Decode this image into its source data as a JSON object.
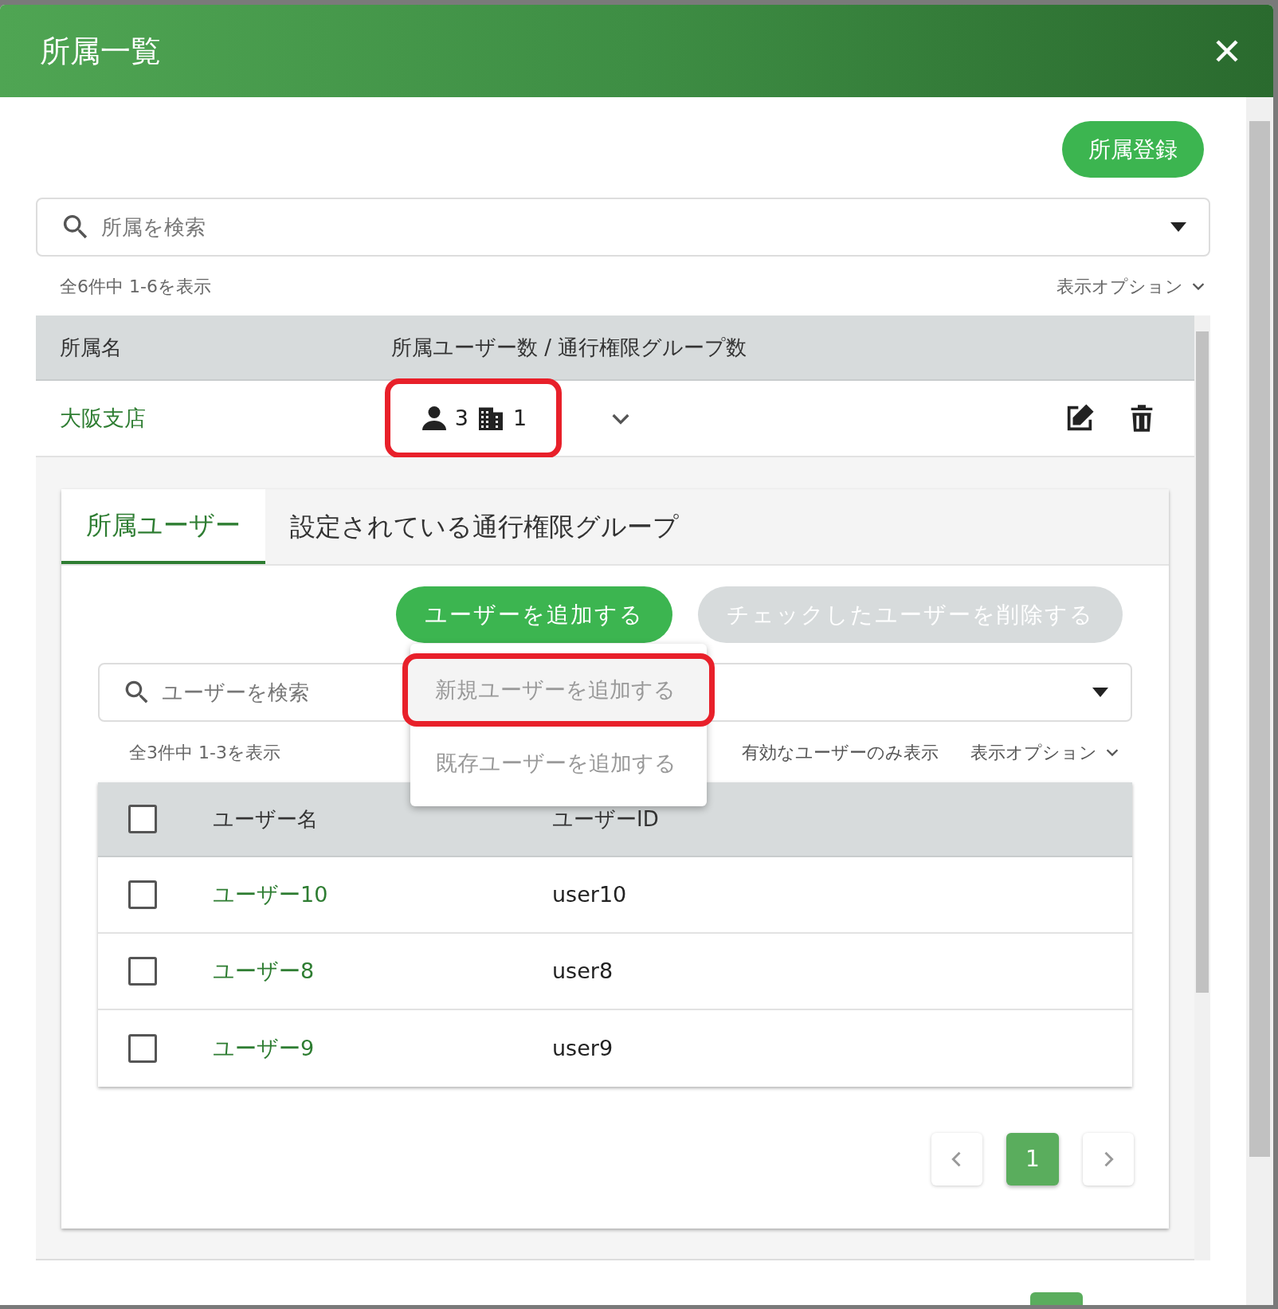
{
  "dialog": {
    "title": "所属一覧"
  },
  "register_button": "所属登録",
  "search": {
    "placeholder": "所属を検索"
  },
  "summary": "全6件中 1-6を表示",
  "display_options": "表示オプション",
  "table": {
    "columns": [
      "所属名",
      "所属ユーザー数 / 通行権限グループ数"
    ],
    "rows": [
      {
        "name": "大阪支店",
        "user_count": "3",
        "group_count": "1",
        "expanded": true
      }
    ]
  },
  "tabs": [
    {
      "label": "所属ユーザー",
      "selected": true
    },
    {
      "label": "設定されている通行権限グループ",
      "selected": false
    }
  ],
  "add_user_button": "ユーザーを追加する",
  "delete_checked_button": {
    "label": "チェックしたユーザーを削除する",
    "disabled": true
  },
  "add_menu": {
    "items": [
      {
        "label": "新規ユーザーを追加する",
        "highlighted": true
      },
      {
        "label": "既存ユーザーを追加する",
        "highlighted": false
      }
    ]
  },
  "user_search": {
    "placeholder": "ユーザーを検索"
  },
  "user_summary": "全3件中 1-3を表示",
  "active_only_filter": "有効なユーザーのみ表示",
  "user_display_options": "表示オプション",
  "user_table": {
    "select_all_checked": false,
    "columns": [
      "ユーザー名",
      "ユーザーID"
    ],
    "rows": [
      {
        "name": "ユーザー10",
        "id": "user10",
        "checked": false
      },
      {
        "name": "ユーザー8",
        "id": "user8",
        "checked": false
      },
      {
        "name": "ユーザー9",
        "id": "user9",
        "checked": false
      }
    ]
  },
  "pagination": {
    "pages": [
      {
        "label": "1",
        "selected": true
      }
    ]
  }
}
